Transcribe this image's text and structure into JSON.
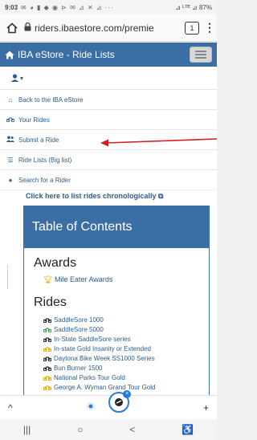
{
  "status": {
    "time": "9:03",
    "notif_icons": "✉ ◕ ▮ ◆ ◉ ⊳ ✉ ⊿ ✕ ⊿ ···",
    "battery": "87%",
    "signal": "⊿ ᴸᵀᴱ ⊿"
  },
  "browser": {
    "url": "riders.ibaestore.com/premie",
    "tab_count": "1",
    "menu": "⋮"
  },
  "navbar": {
    "brand": "IBA eStore - Ride Lists"
  },
  "user": {
    "caret": "▾"
  },
  "menu": [
    {
      "label": "Back to the IBA eStore",
      "icon": "home-icon",
      "glyph": "⌂"
    },
    {
      "label": "Your Rides",
      "icon": "motorcycle-icon",
      "glyph": "⚙"
    },
    {
      "label": "Submit a Ride",
      "icon": "users-icon",
      "glyph": "⚑"
    },
    {
      "label": "Ride Lists (Big list)",
      "icon": "list-icon",
      "glyph": "☰"
    },
    {
      "label": "Search for a Rider",
      "icon": "user-search-icon",
      "glyph": "●"
    }
  ],
  "content": {
    "chron_link": "Click here to list rides chronologically ⧉",
    "toc_title": "Table of Contents",
    "awards_heading": "Awards",
    "award_item": "Mile Eater Awards",
    "rides_heading": "Rides",
    "rides": [
      {
        "label": "SaddleSore 1000",
        "color": "#222222"
      },
      {
        "label": "SaddleSore 5000",
        "color": "#3aa34a"
      },
      {
        "label": "In-State SaddleSore series",
        "color": "#222222"
      },
      {
        "label": "In-state Gold Insanity or Extended",
        "color": "#e0a800"
      },
      {
        "label": "Daytona Bike Week SS1000 Series",
        "color": "#222222"
      },
      {
        "label": "Bun Burner 1500",
        "color": "#222222"
      },
      {
        "label": "National Parks Tour Gold",
        "color": "#e0a800"
      },
      {
        "label": "George A. Wyman Grand Tour Gold",
        "color": "#e0a800"
      }
    ]
  },
  "toolbar": {
    "back": "^",
    "add": "+",
    "tab_badge": "×"
  },
  "sysnav": {
    "recents": "|||",
    "home": "○",
    "back": "<",
    "accessibility": "♿"
  },
  "colors": {
    "brand_blue": "#3a6ea5",
    "link": "#2b5d91",
    "annotation_arrow": "#d21f1f"
  }
}
